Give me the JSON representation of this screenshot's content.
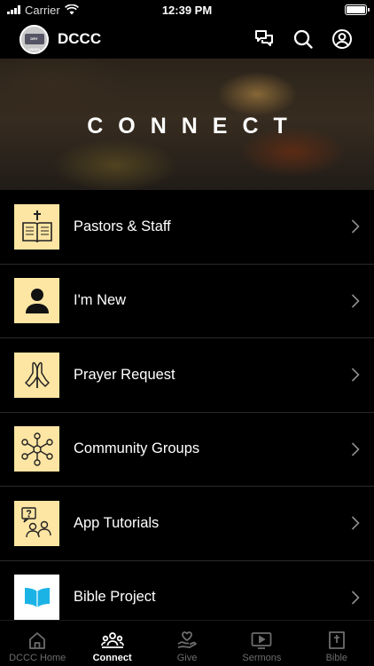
{
  "status": {
    "carrier": "Carrier",
    "time": "12:39 PM"
  },
  "header": {
    "title": "DCCC",
    "logo_text": "DRY CREEK"
  },
  "hero": {
    "title": "CONNECT"
  },
  "menu": [
    {
      "label": "Pastors & Staff",
      "icon": "bible-cross-icon"
    },
    {
      "label": "I'm New",
      "icon": "person-icon"
    },
    {
      "label": "Prayer Request",
      "icon": "praying-hands-icon"
    },
    {
      "label": "Community Groups",
      "icon": "network-icon"
    },
    {
      "label": "App Tutorials",
      "icon": "question-people-icon"
    },
    {
      "label": "Bible Project",
      "icon": "bible-project-logo"
    }
  ],
  "tabs": [
    {
      "label": "DCCC Home",
      "icon": "home-icon",
      "active": false
    },
    {
      "label": "Connect",
      "icon": "people-icon",
      "active": true
    },
    {
      "label": "Give",
      "icon": "give-hand-heart-icon",
      "active": false
    },
    {
      "label": "Sermons",
      "icon": "video-play-icon",
      "active": false
    },
    {
      "label": "Bible",
      "icon": "bible-icon",
      "active": false
    }
  ],
  "colors": {
    "accent_tile": "#fde5a3",
    "background": "#000000",
    "inactive_tab": "#6d6d6d"
  }
}
